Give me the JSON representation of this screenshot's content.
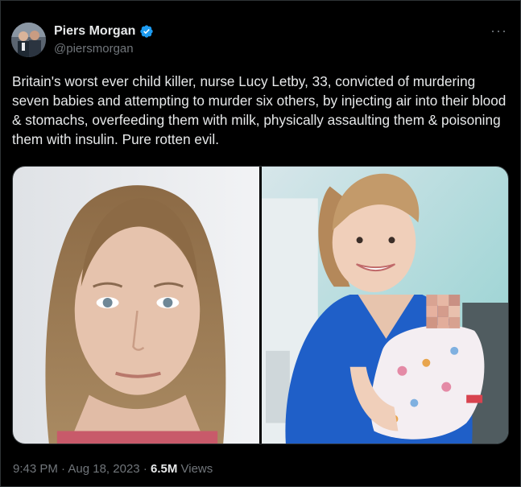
{
  "author": {
    "name": "Piers Morgan",
    "handle": "@piersmorgan",
    "verified": true,
    "badge_color": "#1d9bf0"
  },
  "menu_icon": "more-options-icon",
  "tweet": {
    "text": "Britain's worst ever child killer, nurse Lucy Letby, 33, convicted of murdering seven babies and attempting to murder six others, by injecting air into their blood & stomachs, overfeeding them with milk, physically assaulting them & poisoning them with insulin. Pure rotten evil."
  },
  "media": [
    {
      "kind": "photo",
      "description_icon": "mugshot-photo"
    },
    {
      "kind": "photo",
      "description_icon": "nurse-holding-baby-photo"
    }
  ],
  "meta": {
    "time": "9:43 PM",
    "separator": "·",
    "date": "Aug 18, 2023",
    "views_count": "6.5M",
    "views_label": "Views"
  },
  "colors": {
    "background": "#000000",
    "text": "#e7e9ea",
    "secondary_text": "#71767b",
    "border": "#2f3336"
  }
}
